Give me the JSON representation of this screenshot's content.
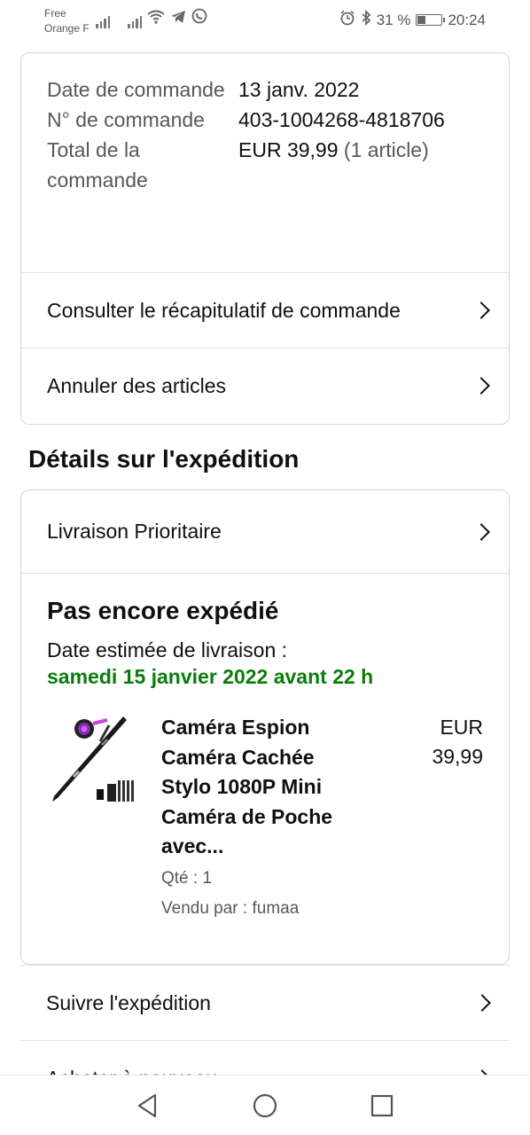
{
  "status_bar": {
    "carrier1": "Free",
    "carrier2": "Orange F",
    "battery": "31 %",
    "time": "20:24"
  },
  "order_summary": {
    "rows": [
      {
        "label": "Date de commande",
        "value": "13 janv. 2022",
        "extra": ""
      },
      {
        "label": "N° de commande",
        "value": "403-1004268-4818706",
        "extra": ""
      },
      {
        "label": "Total de la commande",
        "value": "EUR 39,99",
        "extra": "(1 article)"
      }
    ],
    "view_summary": "Consulter le récapitulatif de commande",
    "cancel_items": "Annuler des articles"
  },
  "shipping": {
    "section_title": "Détails sur l'expédition",
    "method": "Livraison Prioritaire",
    "status": "Pas encore expédié",
    "estimate_label": "Date estimée de livraison :",
    "estimate_date": "samedi 15 janvier 2022 avant 22 h",
    "product": {
      "title": "Caméra Espion Caméra Cachée Stylo 1080P Mini Caméra de Poche avec...",
      "qty": "Qté : 1",
      "seller": "Vendu par : fumaa",
      "price_currency": "EUR",
      "price_value": "39,99"
    },
    "track": "Suivre l'expédition",
    "buy_again": "Acheter à nouveau"
  },
  "colors": {
    "accent_green": "#0a7d0a",
    "border": "#d5d9d9"
  }
}
